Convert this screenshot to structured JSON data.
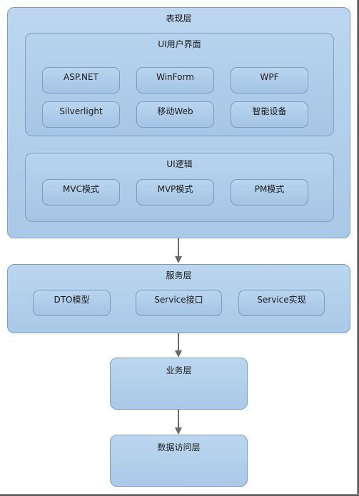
{
  "diagram": {
    "presentation_layer": {
      "title": "表现层",
      "ui_interface": {
        "title": "UI用户界面",
        "items": [
          "ASP.NET",
          "WinForm",
          "WPF",
          "Silverlight",
          "移动Web",
          "智能设备"
        ]
      },
      "ui_logic": {
        "title": "UI逻辑",
        "items": [
          "MVC模式",
          "MVP模式",
          "PM模式"
        ]
      }
    },
    "service_layer": {
      "title": "服务层",
      "items": [
        "DTO模型",
        "Service接口",
        "Service实现"
      ]
    },
    "business_layer": {
      "title": "业务层"
    },
    "data_access_layer": {
      "title": "数据访问层"
    },
    "arrows": [
      {
        "from": "表现层",
        "to": "服务层"
      },
      {
        "from": "服务层",
        "to": "业务层"
      },
      {
        "from": "业务层",
        "to": "数据访问层"
      }
    ],
    "colors": {
      "box_fill": "#b3d0ec",
      "box_border": "#7f9fc4",
      "arrow": "#6a6a6a"
    }
  }
}
